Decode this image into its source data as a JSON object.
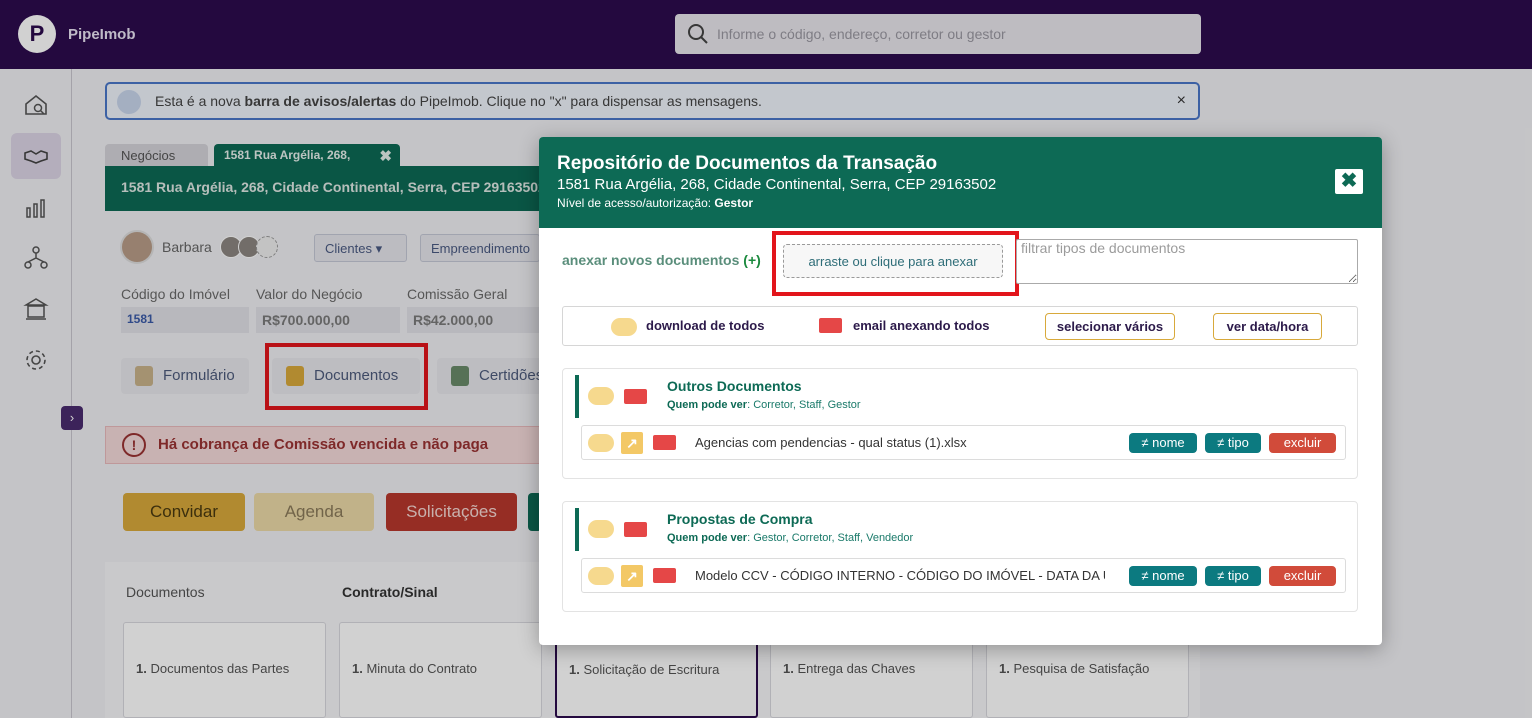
{
  "app": {
    "name": "PipeImob",
    "logo_letter": "P"
  },
  "search": {
    "placeholder": "Informe o código, endereço, corretor ou gestor"
  },
  "sidebar": {
    "items": [
      "home-search-icon",
      "handshake-icon",
      "chart-icon",
      "network-icon",
      "bank-icon",
      "gear-icon"
    ],
    "expand": "›"
  },
  "alert": {
    "pre": "Esta é a nova ",
    "bold": "barra de avisos/alertas",
    "post": " do PipeImob. Clique no \"x\" para dispensar as mensagens.",
    "close": "×"
  },
  "tabs": {
    "tab1": "Negócios",
    "tab2": "1581 Rua Argélia, 268,",
    "tab2_close": "✖"
  },
  "deal": {
    "address": "1581 Rua Argélia, 268, Cidade Continental, Serra, CEP 29163502",
    "broker": "Barbara",
    "dropdowns": [
      "Clientes",
      "Empreendimento"
    ],
    "labels": {
      "code": "Código do Imóvel",
      "value": "Valor do Negócio",
      "commission": "Comissão Geral"
    },
    "values": {
      "code": "1581",
      "value": "R$700.000,00",
      "commission": "R$42.000,00"
    },
    "buttons": [
      "Formulário",
      "Documentos",
      "Certidões"
    ],
    "warning": "Há cobrança de Comissão vencida e não paga",
    "actions": [
      "Convidar",
      "Agenda",
      "Solicitações"
    ],
    "columns": [
      "Documentos",
      "Contrato/Sinal"
    ],
    "cards": [
      {
        "num": "1.",
        "label": "Documentos das Partes"
      },
      {
        "num": "1.",
        "label": "Minuta do Contrato"
      },
      {
        "num": "1.",
        "label": "Solicitação de Escritura"
      },
      {
        "num": "1.",
        "label": "Entrega das Chaves"
      },
      {
        "num": "1.",
        "label": "Pesquisa de Satisfação"
      }
    ]
  },
  "modal": {
    "title": "Repositório de Documentos da Transação",
    "address": "1581 Rua Argélia, 268, Cidade Continental, Serra, CEP 29163502",
    "access_label": "Nível de acesso/autorização: ",
    "access_value": "Gestor",
    "close": "✖",
    "attach_label": "anexar novos documentos",
    "attach_plus": "(+)",
    "dropzone": "arraste ou clique para anexar",
    "filter_placeholder": "filtrar tipos de documentos",
    "toolbar": {
      "download_all": "download de todos",
      "email_all": "email anexando todos",
      "select_many": "selecionar vários",
      "show_datetime": "ver data/hora"
    },
    "sections": [
      {
        "title": "Outros Documentos",
        "who_label": "Quem pode ver",
        "who": ": Corretor, Staff, Gestor",
        "file": "Agencias com pendencias - qual status (1).xlsx"
      },
      {
        "title": "Propostas de Compra",
        "who_label": "Quem pode ver",
        "who": ": Gestor, Corretor, Staff, Vendedor",
        "file": "Modelo CCV - CÓDIGO INTERNO - CÓDIGO DO IMÓVEL - DATA DA ÚL"
      }
    ],
    "pills": {
      "name": "≠ nome",
      "type": "≠ tipo",
      "delete": "excluir"
    }
  },
  "colors": {
    "brand": "#2c0c4e",
    "green": "#0d6a55",
    "danger": "#d14b3a",
    "highlight": "#e2151b"
  }
}
